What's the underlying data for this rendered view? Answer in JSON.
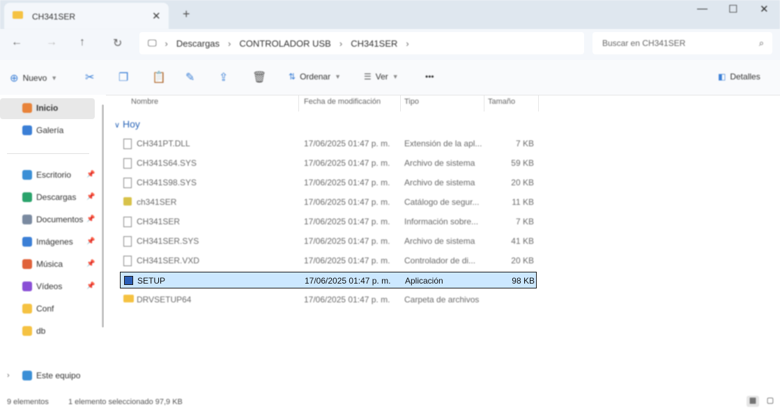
{
  "tab": {
    "title": "CH341SER",
    "close": "✕",
    "new": "+"
  },
  "window": {
    "minimize": "—",
    "maximize": "☐",
    "close": "✕"
  },
  "nav": {
    "back": "←",
    "forward": "→",
    "up": "↑",
    "refresh": "↻",
    "chevron": "›"
  },
  "breadcrumb": [
    "Descargas",
    "CONTROLADOR USB",
    "CH341SER"
  ],
  "search": {
    "placeholder": "Buscar en CH341SER"
  },
  "toolbar": {
    "new_label": "Nuevo",
    "sort_label": "Ordenar",
    "view_label": "Ver",
    "more": "•••",
    "details_label": "Detalles"
  },
  "sidebar": {
    "items": [
      {
        "label": "Inicio",
        "icon": "home-icon",
        "color": "#e8833a"
      },
      {
        "label": "Galería",
        "icon": "gallery-icon",
        "color": "#3b7fd6"
      },
      {
        "label": "Escritorio",
        "icon": "desktop-icon",
        "color": "#3b8fd6"
      },
      {
        "label": "Descargas",
        "icon": "download-icon",
        "color": "#2aa36b"
      },
      {
        "label": "Documentos",
        "icon": "documents-icon",
        "color": "#7a8aa0"
      },
      {
        "label": "Imágenes",
        "icon": "pictures-icon",
        "color": "#3b7fd6"
      },
      {
        "label": "Música",
        "icon": "music-icon",
        "color": "#e0623a"
      },
      {
        "label": "Vídeos",
        "icon": "videos-icon",
        "color": "#8a4fd6"
      },
      {
        "label": "Conf",
        "icon": "folder-icon",
        "color": "#f5c242"
      },
      {
        "label": "db",
        "icon": "folder-icon",
        "color": "#f5c242"
      },
      {
        "label": "Este equipo",
        "icon": "computer-icon",
        "color": "#3b8fd6"
      }
    ],
    "pin": "📌"
  },
  "columns": {
    "name": "Nombre",
    "date": "Fecha de modificación",
    "type": "Tipo",
    "size": "Tamaño"
  },
  "group": {
    "label": "Hoy",
    "chevron": "∨"
  },
  "files": [
    {
      "name": "CH341PT.DLL",
      "date": "17/06/2025 01:47 p. m.",
      "type": "Extensión de la apl...",
      "size": "7 KB",
      "icon": "file-icon"
    },
    {
      "name": "CH341S64.SYS",
      "date": "17/06/2025 01:47 p. m.",
      "type": "Archivo de sistema",
      "size": "59 KB",
      "icon": "file-icon"
    },
    {
      "name": "CH341S98.SYS",
      "date": "17/06/2025 01:47 p. m.",
      "type": "Archivo de sistema",
      "size": "20 KB",
      "icon": "file-icon"
    },
    {
      "name": "ch341SER",
      "date": "17/06/2025 01:47 p. m.",
      "type": "Catálogo de segur...",
      "size": "11 KB",
      "icon": "catalog-icon"
    },
    {
      "name": "CH341SER",
      "date": "17/06/2025 01:47 p. m.",
      "type": "Información sobre...",
      "size": "7 KB",
      "icon": "file-icon"
    },
    {
      "name": "CH341SER.SYS",
      "date": "17/06/2025 01:47 p. m.",
      "type": "Archivo de sistema",
      "size": "41 KB",
      "icon": "file-icon"
    },
    {
      "name": "CH341SER.VXD",
      "date": "17/06/2025 01:47 p. m.",
      "type": "Controlador de di...",
      "size": "20 KB",
      "icon": "file-icon"
    },
    {
      "name": "SETUP",
      "date": "17/06/2025 01:47 p. m.",
      "type": "Aplicación",
      "size": "98 KB",
      "icon": "setup-icon"
    },
    {
      "name": "DRVSETUP64",
      "date": "17/06/2025 01:47 p. m.",
      "type": "Carpeta de archivos",
      "size": "",
      "icon": "folder-icon"
    }
  ],
  "status": {
    "count": "9 elementos",
    "selected": "1 elemento seleccionado  97,9 KB"
  },
  "colors": {
    "accent": "#3b7fd6",
    "selection": "#cce8ff"
  }
}
